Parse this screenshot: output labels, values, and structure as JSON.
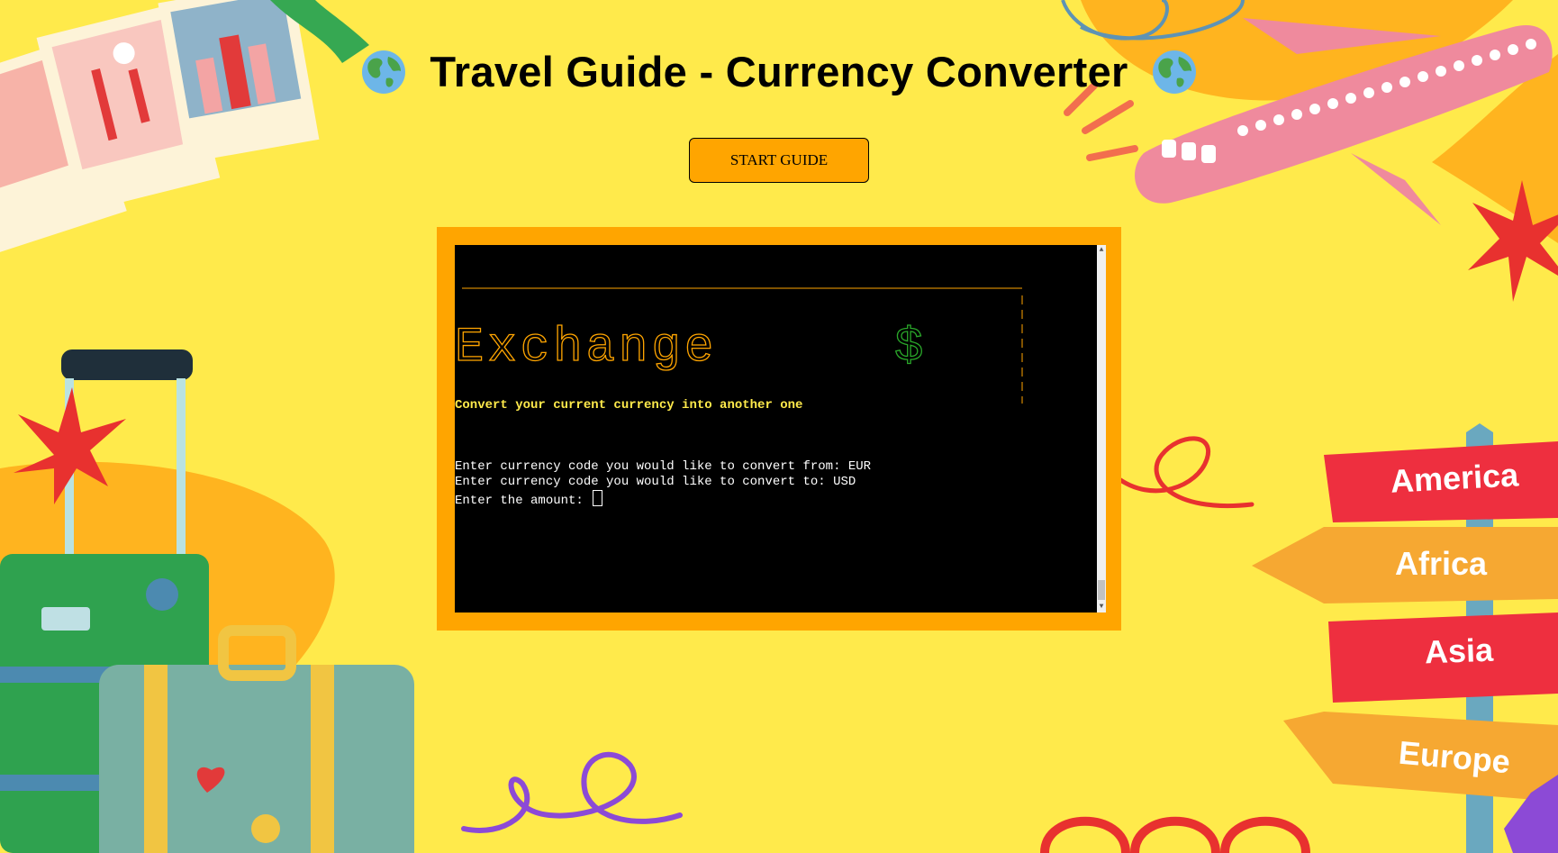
{
  "header": {
    "title": "Travel Guide - Currency Converter",
    "left_icon": "globe-icon",
    "right_icon": "globe-icon"
  },
  "start_button": {
    "label": "START GUIDE"
  },
  "terminal": {
    "banner_word": "Exchange",
    "banner_symbol": "$",
    "tagline": "Convert your current currency into another one",
    "lines": [
      "Enter currency code you would like to convert from: EUR",
      "Enter currency code you would like to convert to: USD",
      "Enter the amount: "
    ]
  },
  "signpost": {
    "signs": [
      "America",
      "Africa",
      "Asia",
      "Europe"
    ]
  },
  "colors": {
    "background": "#ffea4b",
    "accent": "#ffa500",
    "terminal_bg": "#000000",
    "banner_text": "#ffa500",
    "symbol_text": "#2aa82a",
    "tagline_text": "#ffea4b"
  }
}
